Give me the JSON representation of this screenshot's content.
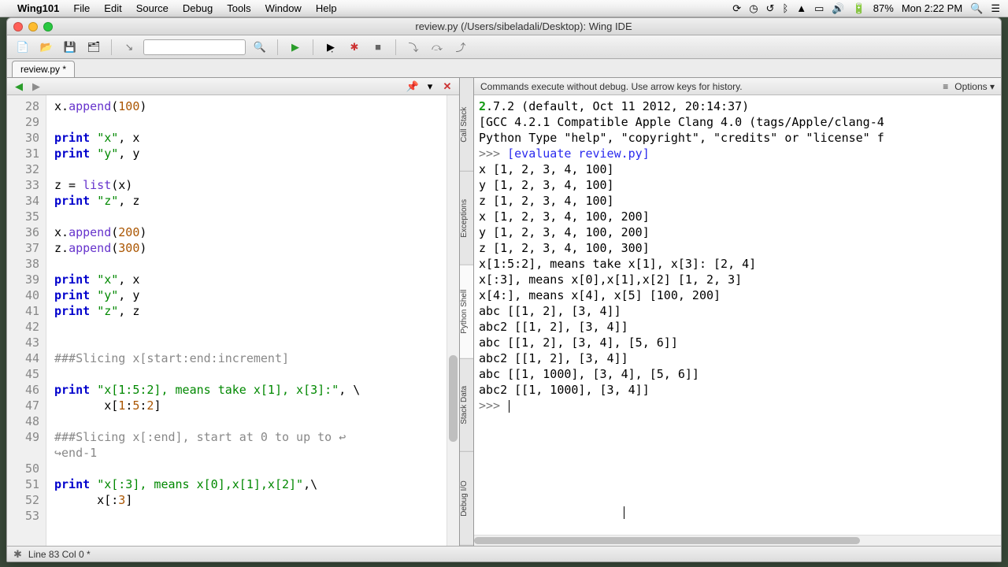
{
  "menubar": {
    "app": "Wing101",
    "items": [
      "File",
      "Edit",
      "Source",
      "Debug",
      "Tools",
      "Window",
      "Help"
    ],
    "battery": "87%",
    "clock": "Mon 2:22 PM"
  },
  "window": {
    "title": "review.py (/Users/sibeladali/Desktop): Wing IDE"
  },
  "filetab": "review.py *",
  "editor": {
    "lines": [
      {
        "n": 28,
        "tokens": [
          [
            "x.",
            ""
          ],
          [
            "append",
            "fn"
          ],
          [
            "(",
            ""
          ],
          [
            "100",
            "num"
          ],
          [
            ")",
            ""
          ]
        ]
      },
      {
        "n": 29,
        "tokens": []
      },
      {
        "n": 30,
        "tokens": [
          [
            "print",
            "kw"
          ],
          [
            " ",
            ""
          ],
          [
            "\"x\"",
            "str"
          ],
          [
            ", x",
            ""
          ]
        ]
      },
      {
        "n": 31,
        "tokens": [
          [
            "print",
            "kw"
          ],
          [
            " ",
            ""
          ],
          [
            "\"y\"",
            "str"
          ],
          [
            ", y",
            ""
          ]
        ]
      },
      {
        "n": 32,
        "tokens": []
      },
      {
        "n": 33,
        "tokens": [
          [
            "z = ",
            ""
          ],
          [
            "list",
            "fn"
          ],
          [
            "(x)",
            ""
          ]
        ]
      },
      {
        "n": 34,
        "tokens": [
          [
            "print",
            "kw"
          ],
          [
            " ",
            ""
          ],
          [
            "\"z\"",
            "str"
          ],
          [
            ", z",
            ""
          ]
        ]
      },
      {
        "n": 35,
        "tokens": []
      },
      {
        "n": 36,
        "tokens": [
          [
            "x.",
            ""
          ],
          [
            "append",
            "fn"
          ],
          [
            "(",
            ""
          ],
          [
            "200",
            "num"
          ],
          [
            ")",
            ""
          ]
        ]
      },
      {
        "n": 37,
        "tokens": [
          [
            "z.",
            ""
          ],
          [
            "append",
            "fn"
          ],
          [
            "(",
            ""
          ],
          [
            "300",
            "num"
          ],
          [
            ")",
            ""
          ]
        ]
      },
      {
        "n": 38,
        "tokens": []
      },
      {
        "n": 39,
        "tokens": [
          [
            "print",
            "kw"
          ],
          [
            " ",
            ""
          ],
          [
            "\"x\"",
            "str"
          ],
          [
            ", x",
            ""
          ]
        ]
      },
      {
        "n": 40,
        "tokens": [
          [
            "print",
            "kw"
          ],
          [
            " ",
            ""
          ],
          [
            "\"y\"",
            "str"
          ],
          [
            ", y",
            ""
          ]
        ]
      },
      {
        "n": 41,
        "tokens": [
          [
            "print",
            "kw"
          ],
          [
            " ",
            ""
          ],
          [
            "\"z\"",
            "str"
          ],
          [
            ", z",
            ""
          ]
        ]
      },
      {
        "n": 42,
        "tokens": []
      },
      {
        "n": 43,
        "tokens": []
      },
      {
        "n": 44,
        "tokens": [
          [
            "###Slicing x[start:end:increment]",
            "com"
          ]
        ]
      },
      {
        "n": 45,
        "tokens": []
      },
      {
        "n": 46,
        "tokens": [
          [
            "print",
            "kw"
          ],
          [
            " ",
            ""
          ],
          [
            "\"x[1:5:2], means take x[1], x[3]:\"",
            "str"
          ],
          [
            ", \\",
            ""
          ]
        ]
      },
      {
        "n": 47,
        "tokens": [
          [
            "       x[",
            ""
          ],
          [
            "1",
            "num"
          ],
          [
            ":",
            ""
          ],
          [
            "5",
            "num"
          ],
          [
            ":",
            ""
          ],
          [
            "2",
            "num"
          ],
          [
            "]",
            ""
          ]
        ]
      },
      {
        "n": 48,
        "tokens": []
      },
      {
        "n": 49,
        "tokens": [
          [
            "###Slicing x[:end], start at 0 to up to ",
            "com"
          ],
          [
            "↩",
            "com"
          ]
        ]
      },
      {
        "n": "",
        "tokens": [
          [
            "↪",
            "com"
          ],
          [
            "end-1",
            "com"
          ]
        ]
      },
      {
        "n": 50,
        "tokens": []
      },
      {
        "n": 51,
        "tokens": [
          [
            "print",
            "kw"
          ],
          [
            " ",
            ""
          ],
          [
            "\"x[:3], means x[0],x[1],x[2]\"",
            "str"
          ],
          [
            ",\\",
            ""
          ]
        ]
      },
      {
        "n": 52,
        "tokens": [
          [
            "      x[:",
            ""
          ],
          [
            "3",
            "num"
          ],
          [
            "]",
            ""
          ]
        ]
      },
      {
        "n": 53,
        "tokens": []
      }
    ]
  },
  "vtabs": [
    "Call Stack",
    "Exceptions",
    "Python Shell",
    "Stack Data",
    "Debug I/O"
  ],
  "vtab_active": 2,
  "shell": {
    "hint": "Commands execute without debug.  Use arrow keys for history.",
    "options_label": "Options",
    "lines": [
      {
        "seg": [
          [
            "2",
            "ver"
          ],
          [
            ".7.2 (default, Oct 11 2012, 20:14:37)",
            ""
          ]
        ]
      },
      {
        "seg": [
          [
            "[GCC 4.2.1 Compatible Apple Clang 4.0 (tags/Apple/clang-4",
            ""
          ]
        ]
      },
      {
        "seg": [
          [
            "Python Type \"help\", \"copyright\", \"credits\" or \"license\" f",
            ""
          ]
        ]
      },
      {
        "seg": [
          [
            ">>> ",
            "prompt"
          ],
          [
            "[evaluate review.py]",
            "cmd"
          ]
        ]
      },
      {
        "seg": [
          [
            "x [1, 2, 3, 4, 100]",
            ""
          ]
        ]
      },
      {
        "seg": [
          [
            "y [1, 2, 3, 4, 100]",
            ""
          ]
        ]
      },
      {
        "seg": [
          [
            "z [1, 2, 3, 4, 100]",
            ""
          ]
        ]
      },
      {
        "seg": [
          [
            "x [1, 2, 3, 4, 100, 200]",
            ""
          ]
        ]
      },
      {
        "seg": [
          [
            "y [1, 2, 3, 4, 100, 200]",
            ""
          ]
        ]
      },
      {
        "seg": [
          [
            "z [1, 2, 3, 4, 100, 300]",
            ""
          ]
        ]
      },
      {
        "seg": [
          [
            "x[1:5:2], means take x[1], x[3]: [2, 4]",
            ""
          ]
        ]
      },
      {
        "seg": [
          [
            "x[:3], means x[0],x[1],x[2] [1, 2, 3]",
            ""
          ]
        ]
      },
      {
        "seg": [
          [
            "x[4:], means x[4], x[5] [100, 200]",
            ""
          ]
        ]
      },
      {
        "seg": [
          [
            "",
            ""
          ]
        ]
      },
      {
        "seg": [
          [
            "abc [[1, 2], [3, 4]]",
            ""
          ]
        ]
      },
      {
        "seg": [
          [
            "abc2 [[1, 2], [3, 4]]",
            ""
          ]
        ]
      },
      {
        "seg": [
          [
            "",
            ""
          ]
        ]
      },
      {
        "seg": [
          [
            "abc [[1, 2], [3, 4], [5, 6]]",
            ""
          ]
        ]
      },
      {
        "seg": [
          [
            "abc2 [[1, 2], [3, 4]]",
            ""
          ]
        ]
      },
      {
        "seg": [
          [
            "",
            ""
          ]
        ]
      },
      {
        "seg": [
          [
            "abc [[1, 1000], [3, 4], [5, 6]]",
            ""
          ]
        ]
      },
      {
        "seg": [
          [
            "abc2 [[1, 1000], [3, 4]]",
            ""
          ]
        ]
      },
      {
        "seg": [
          [
            ">>> ",
            "prompt"
          ]
        ],
        "cursor": true
      }
    ]
  },
  "status": "Line 83 Col 0 *"
}
